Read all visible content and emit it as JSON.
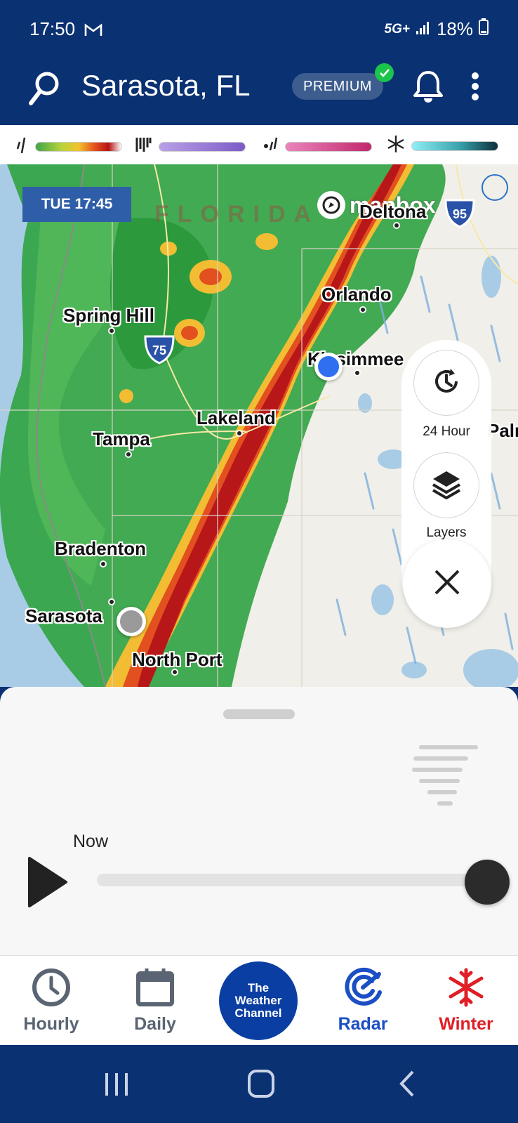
{
  "status_bar": {
    "time": "17:50",
    "mail_icon": "gmail-icon",
    "network": "5G+",
    "battery": "18%"
  },
  "header": {
    "location": "Sarasota, FL",
    "premium_label": "PREMIUM",
    "icons": [
      "search-icon",
      "bell-icon",
      "more-vert-icon"
    ]
  },
  "legend": {
    "items": [
      {
        "icon": "rain-icon",
        "gradient": [
          "#3fa547",
          "#b6d33b",
          "#f3c22d",
          "#e34b1e",
          "#b41515",
          "#ffffff"
        ]
      },
      {
        "icon": "mix-icon",
        "gradient": [
          "#b9a0e6",
          "#7d5ac8"
        ]
      },
      {
        "icon": "ice-icon",
        "gradient": [
          "#ea85bd",
          "#c2276c"
        ]
      },
      {
        "icon": "snow-icon",
        "gradient": [
          "#8ff0f5",
          "#3aa3ad",
          "#0c2f3a"
        ]
      }
    ]
  },
  "map": {
    "timestamp": "TUE 17:45",
    "attribution": "mapbox",
    "state_label": "FLORIDA",
    "cities": [
      {
        "name": "Deltona"
      },
      {
        "name": "Orlando"
      },
      {
        "name": "Spring Hill"
      },
      {
        "name": "Kissimmee"
      },
      {
        "name": "Lakeland"
      },
      {
        "name": "Tampa"
      },
      {
        "name": "Bradenton"
      },
      {
        "name": "Sarasota"
      },
      {
        "name": "North Port"
      },
      {
        "name": "Palm"
      }
    ],
    "highways": [
      "95",
      "75"
    ],
    "controls": {
      "time_range_label": "24 Hour",
      "layers_label": "Layers"
    }
  },
  "player": {
    "now_label": "Now",
    "progress": 1.0
  },
  "tabs": [
    {
      "label": "Hourly",
      "color": "#5a6472",
      "active": false
    },
    {
      "label": "Daily",
      "color": "#5a6472",
      "active": false
    },
    {
      "label": "Radar",
      "color": "#1c4fc4",
      "active": true
    },
    {
      "label": "Winter",
      "color": "#e01e26",
      "active": false
    }
  ],
  "brand": {
    "line1": "The",
    "line2": "Weather",
    "line3": "Channel"
  }
}
